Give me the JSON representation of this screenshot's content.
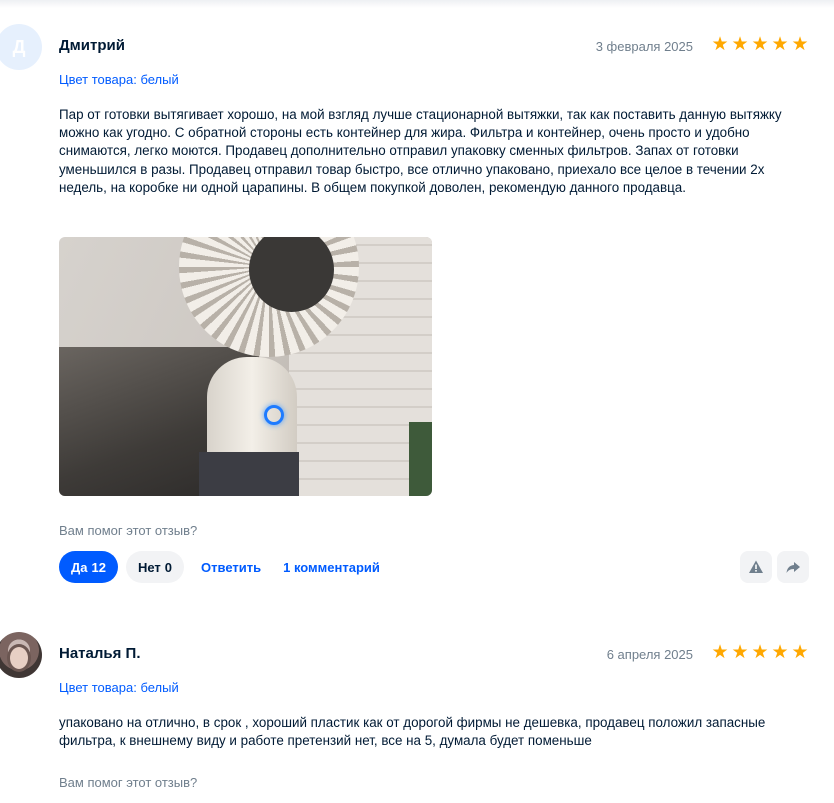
{
  "reviews": [
    {
      "author": "Дмитрий",
      "avatar_letter": "Д",
      "date": "3 февраля 2025",
      "rating": 5,
      "product_color": "Цвет товара: белый",
      "text": "Пар от готовки вытягивает хорошо, на мой взгляд лучше стационарной вытяжки, так как поставить данную вытяжку можно как угодно. С обратной стороны есть контейнер для жира. Фильтра и контейнер, очень просто и удобно снимаются, легко моются. Продавец дополнительно отправил упаковку сменных фильтров. Запах от готовки уменьшился в разы. Продавец отправил товар быстро, все отлично упаковано, приехало все целое в течении 2х недель, на коробке ни одной царапины. В общем покупкой доволен, рекомендую данного продавца.",
      "helpful_question": "Вам помог этот отзыв?",
      "yes_label": "Да",
      "yes_count": "12",
      "no_label": "Нет",
      "no_count": "0",
      "reply_label": "Ответить",
      "comments_label": "1 комментарий"
    },
    {
      "author": "Наталья П.",
      "date": "6 апреля 2025",
      "rating": 5,
      "product_color": "Цвет товара: белый",
      "text": "упаковано на отлично, в срок , хороший пластик как от дорогой фирмы не дешевка, продавец положил запасные фильтра, к внешнему виду и работе претензий нет, все на 5, думала будет поменьше",
      "helpful_question": "Вам помог этот отзыв?"
    }
  ],
  "icons": {
    "star": "star-icon",
    "report": "warning-icon",
    "share": "share-arrow-icon"
  },
  "colors": {
    "accent": "#005bff",
    "star": "#ffa800",
    "muted": "#707f8d"
  }
}
